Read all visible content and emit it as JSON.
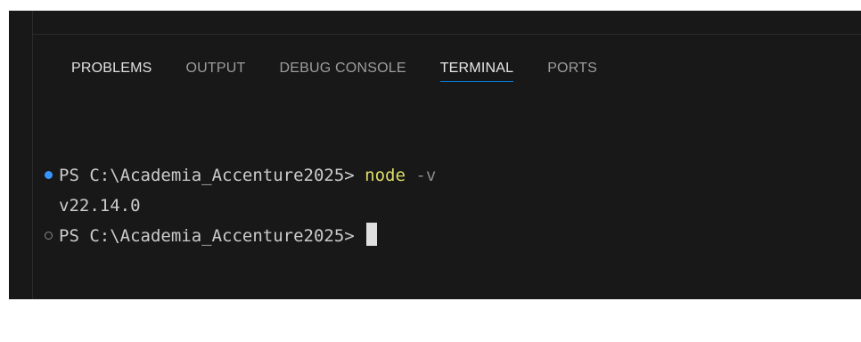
{
  "panel": {
    "tabs": [
      {
        "label": "PROBLEMS"
      },
      {
        "label": "OUTPUT"
      },
      {
        "label": "DEBUG CONSOLE"
      },
      {
        "label": "TERMINAL",
        "active": true
      },
      {
        "label": "PORTS"
      }
    ]
  },
  "terminal": {
    "lines": [
      {
        "decoration": "success",
        "prompt": "PS C:\\Academia_Accenture2025> ",
        "command": "node",
        "args": " -v"
      },
      {
        "output": "v22.14.0"
      },
      {
        "decoration": "empty",
        "prompt": "PS C:\\Academia_Accenture2025> "
      }
    ]
  },
  "colors": {
    "background": "#181818",
    "active_tab_underline": "#0078d4",
    "success_decoration": "#3794ff",
    "command": "#dcdc6a"
  }
}
